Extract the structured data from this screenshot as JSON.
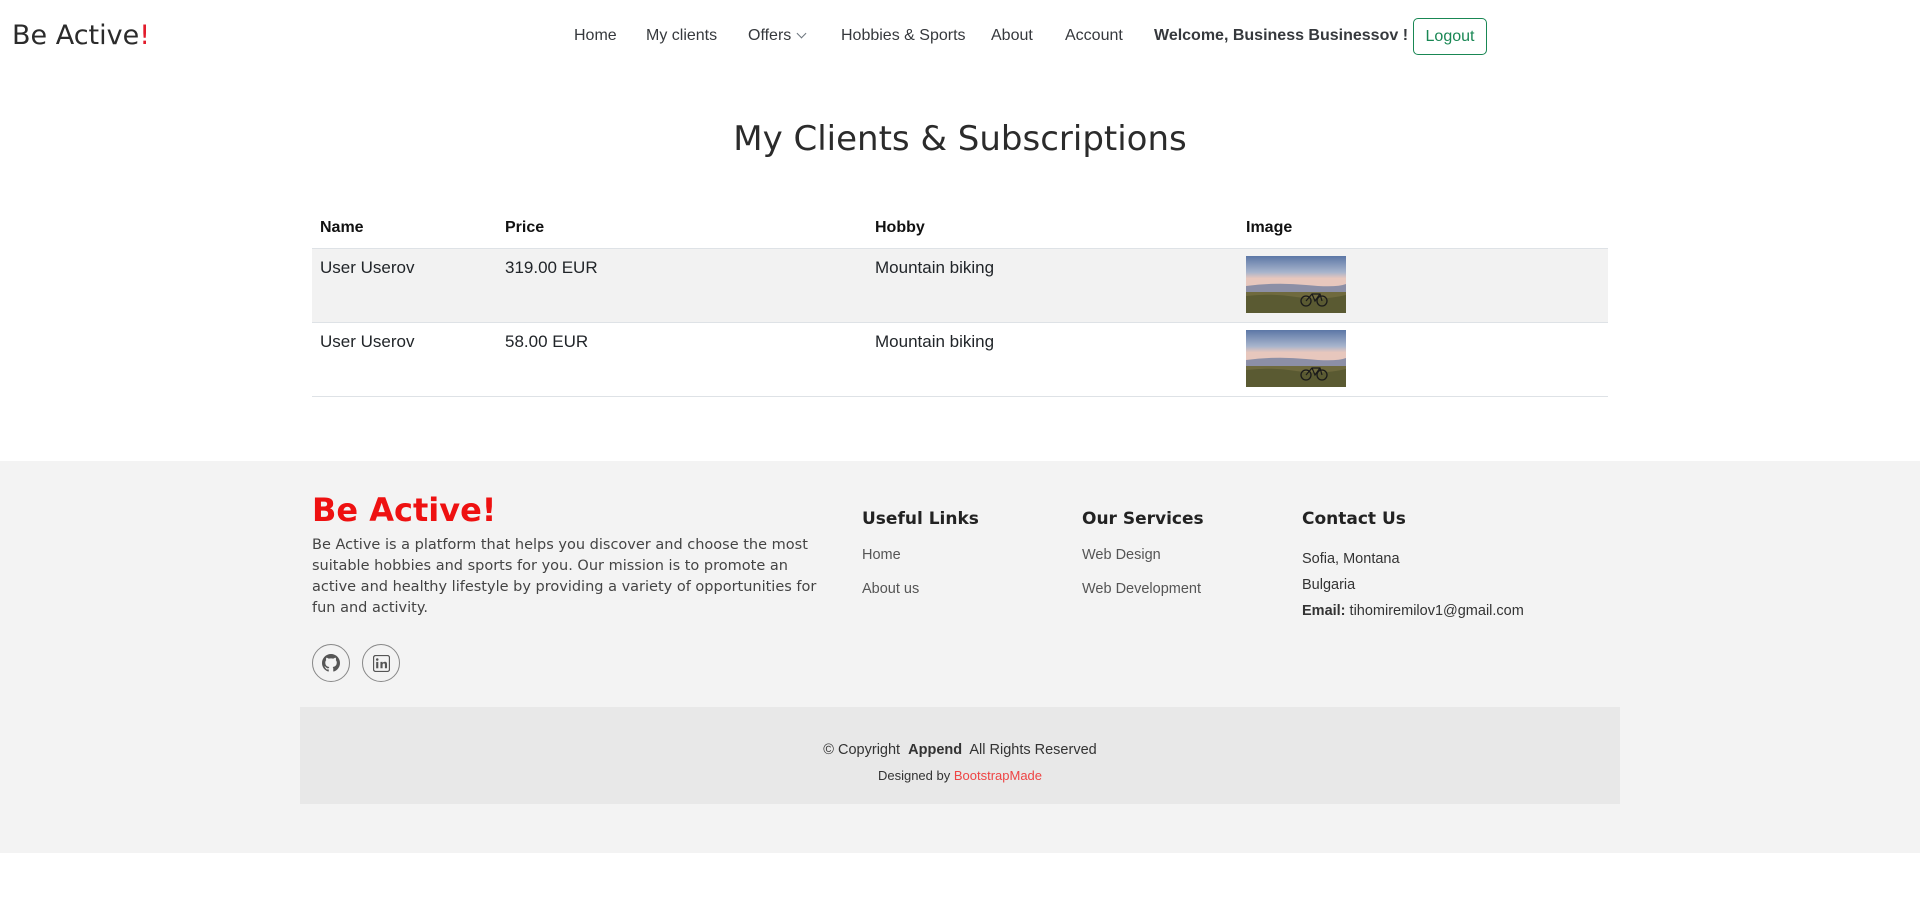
{
  "header": {
    "logo_text": "Be Active",
    "logo_mark": "!",
    "nav": {
      "home": "Home",
      "my_clients": "My clients",
      "offers": "Offers",
      "hobbies": "Hobbies & Sports",
      "about": "About",
      "account": "Account",
      "welcome": "Welcome, Business Businessov !"
    },
    "logout_label": "Logout"
  },
  "main": {
    "title": "My Clients & Subscriptions",
    "columns": [
      "Name",
      "Price",
      "Hobby",
      "Image"
    ],
    "rows": [
      {
        "name": "User Userov",
        "price": "319.00 EUR",
        "hobby": "Mountain biking",
        "image": "mountain-bike-photo"
      },
      {
        "name": "User Userov",
        "price": "58.00 EUR",
        "hobby": "Mountain biking",
        "image": "mountain-bike-photo"
      }
    ]
  },
  "footer": {
    "brand": "Be Active!",
    "description": "Be Active is a platform that helps you discover and choose the most suitable hobbies and sports for you. Our mission is to promote an active and healthy lifestyle by providing a variety of opportunities for fun and activity.",
    "social": [
      "github-icon",
      "linkedin-icon"
    ],
    "useful_links": {
      "heading": "Useful Links",
      "items": [
        "Home",
        "About us"
      ]
    },
    "services": {
      "heading": "Our Services",
      "items": [
        "Web Design",
        "Web Development"
      ]
    },
    "contact": {
      "heading": "Contact Us",
      "city": "Sofia, Montana",
      "country": "Bulgaria",
      "email_label": "Email:",
      "email": "tihomiremilov1@gmail.com"
    },
    "copyright_prefix": "© Copyright",
    "copyright_brand": "Append",
    "copyright_suffix": "All Rights Reserved",
    "designed_by": "Designed by",
    "designer": "BootstrapMade"
  },
  "colors": {
    "brand_red": "#ee1111",
    "logout_green": "#198754",
    "footer_bg": "#f3f3f3"
  }
}
